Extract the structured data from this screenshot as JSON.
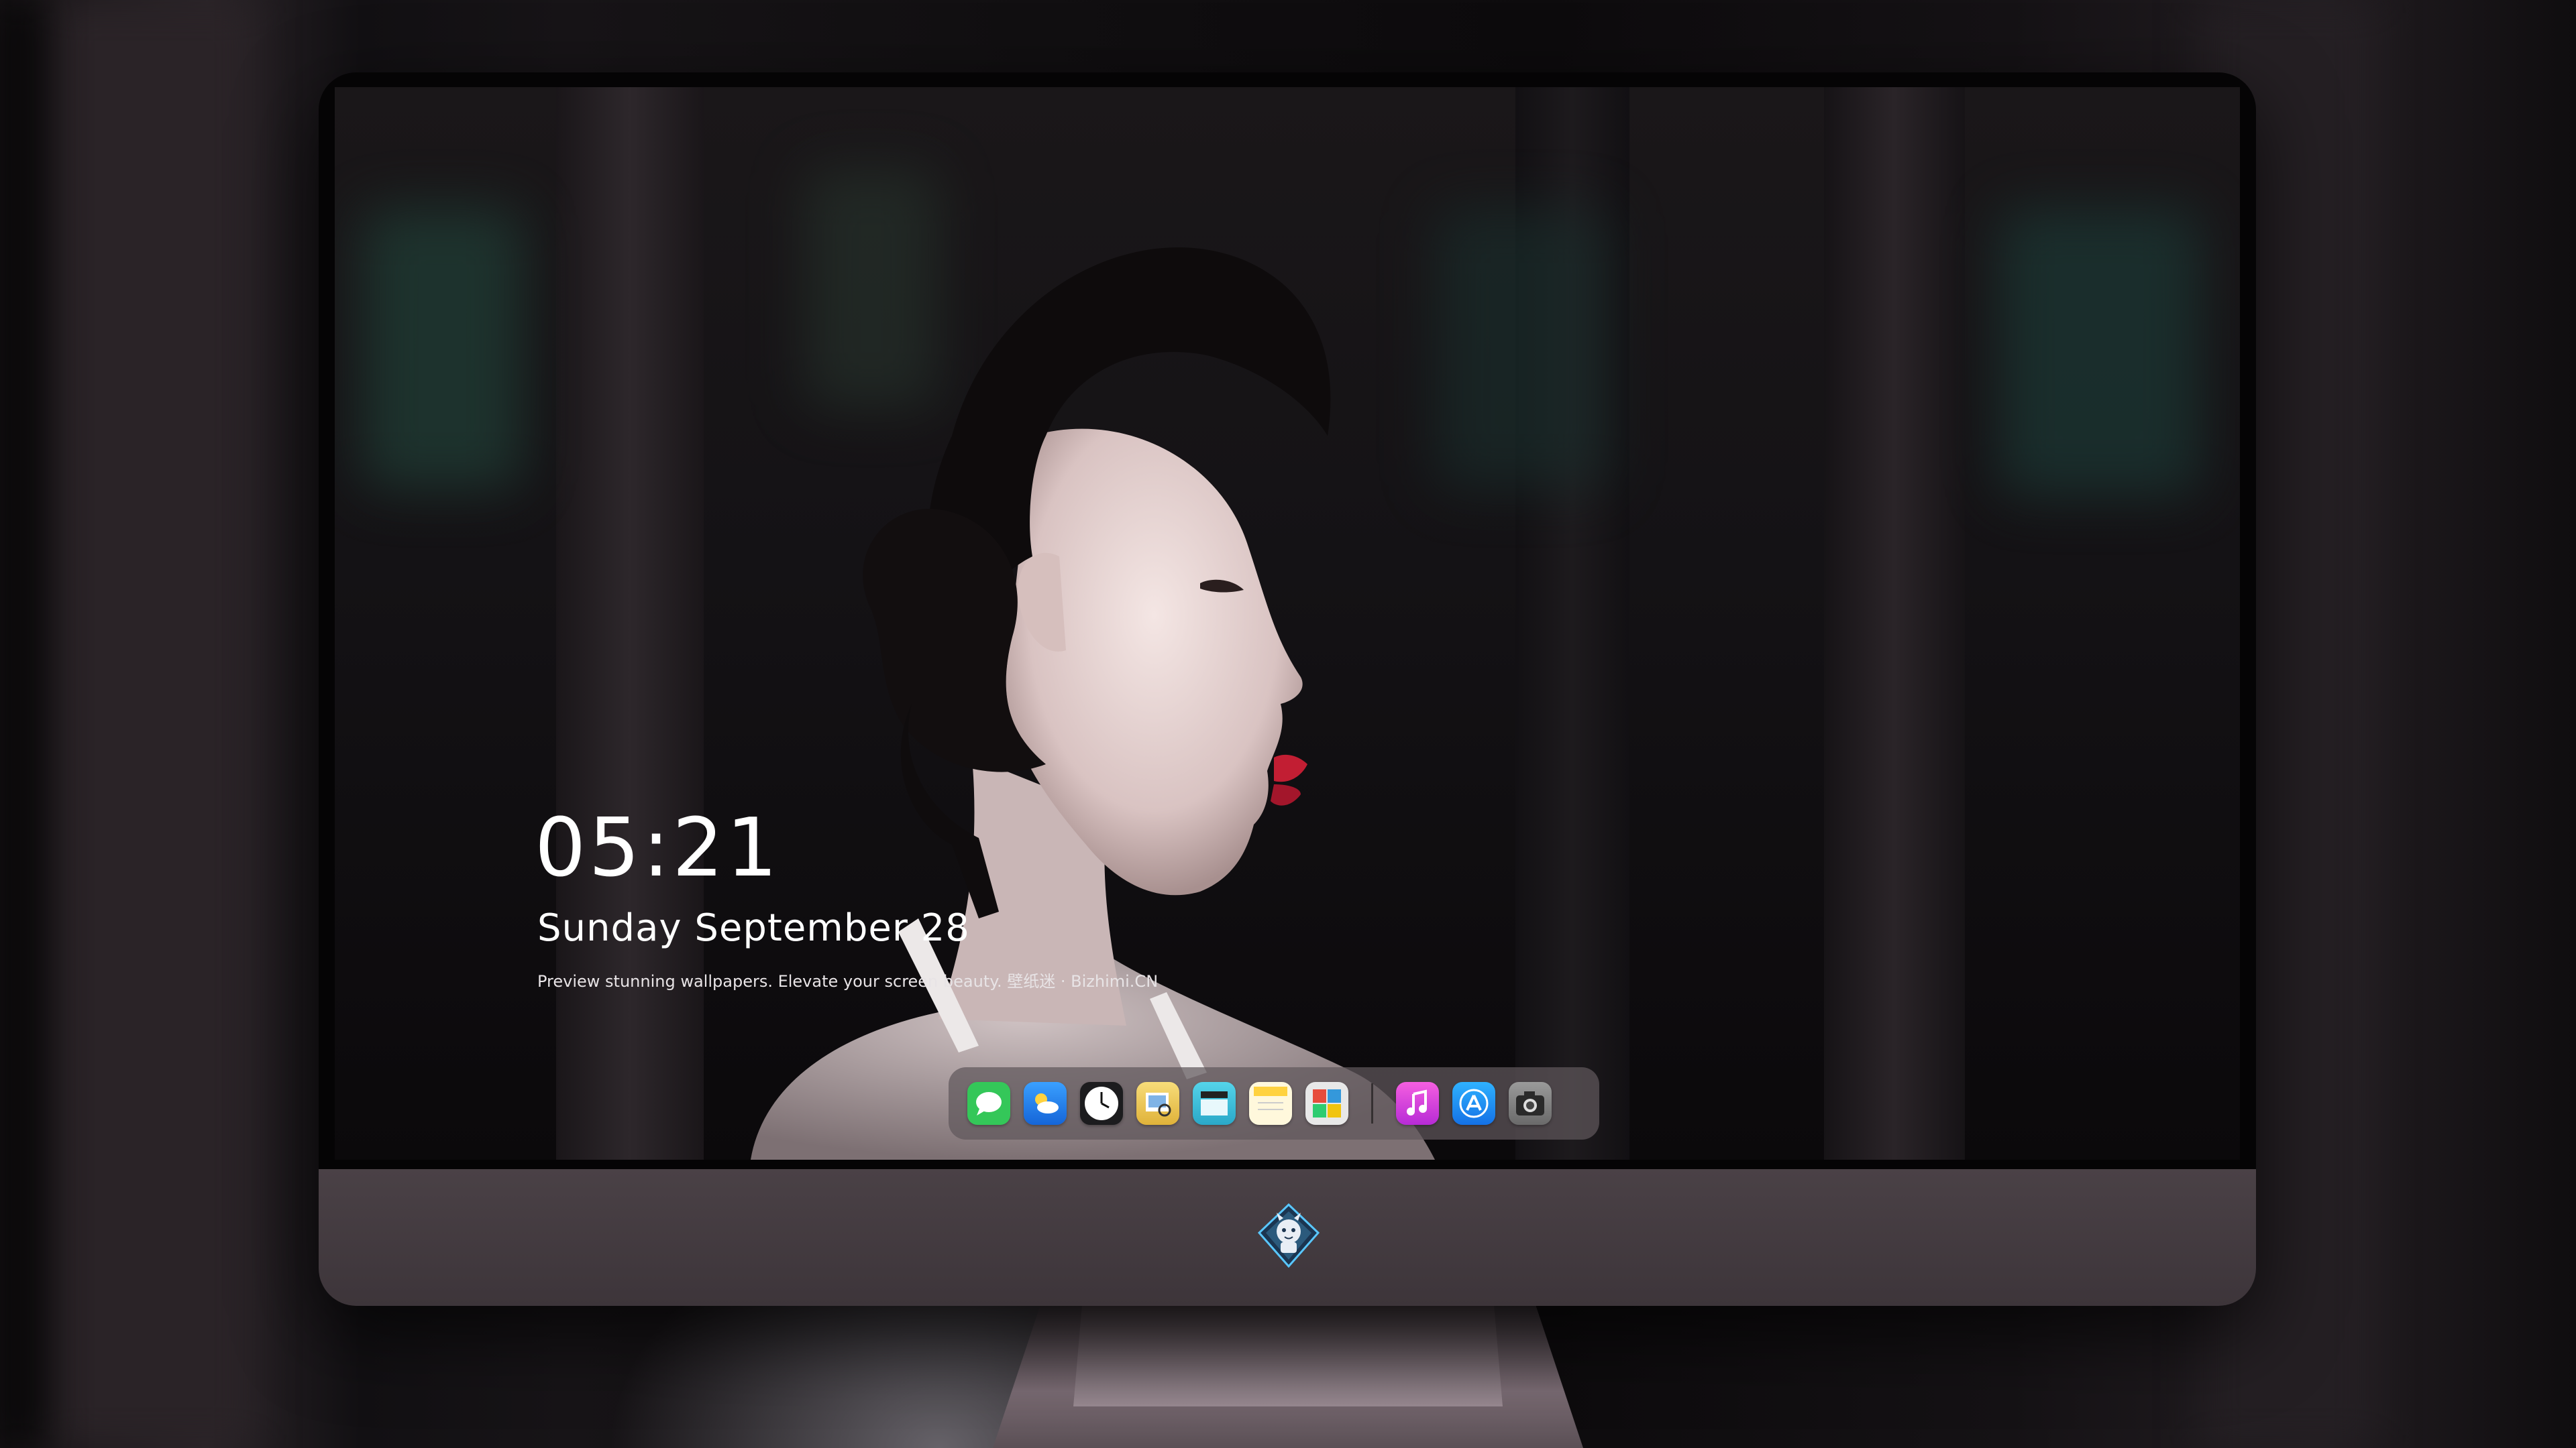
{
  "lockscreen": {
    "time": "05:21",
    "date": "Sunday September  28",
    "caption": "Preview stunning wallpapers. Elevate your screen beauty. 壁纸迷 · Bizhimi.CN"
  },
  "dock": {
    "items": [
      {
        "name": "messages-icon",
        "color": "#34c759"
      },
      {
        "name": "weather-icon",
        "color": "#1e90ff"
      },
      {
        "name": "clock-icon",
        "color": "#1c1c1e"
      },
      {
        "name": "preview-icon",
        "color": "#f2c94c"
      },
      {
        "name": "clips-icon",
        "color": "#3ec6e0"
      },
      {
        "name": "notes-icon",
        "color": "#ffd54a"
      },
      {
        "name": "photo-booth-icon",
        "color": "#e8e8e8"
      },
      {
        "name": "music-icon",
        "color": "#e33bd0"
      },
      {
        "name": "app-store-icon",
        "color": "#1d8cf8"
      },
      {
        "name": "camera-icon",
        "color": "#8a8a8a"
      }
    ]
  },
  "chin": {
    "logo": "dragon-badge-logo"
  }
}
